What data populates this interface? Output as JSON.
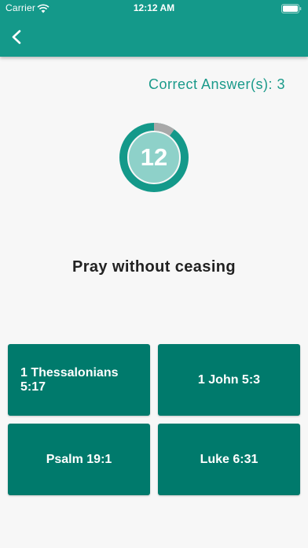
{
  "status_bar": {
    "carrier": "Carrier",
    "time": "12:12 AM"
  },
  "nav": {
    "back_icon": "chevron-left-icon"
  },
  "score": {
    "label": "Correct Answer(s): 3"
  },
  "timer": {
    "value": "12",
    "remaining_fraction": 0.9,
    "colors": {
      "ring": "#14998a",
      "elapsed": "#a8a8a8",
      "inner": "#8ed1c9"
    }
  },
  "question": {
    "text": "Pray without ceasing"
  },
  "answers": [
    {
      "label": "1 Thessalonians 5:17"
    },
    {
      "label": "1 John 5:3"
    },
    {
      "label": "Psalm 19:1"
    },
    {
      "label": "Luke 6:31"
    }
  ],
  "colors": {
    "primary": "#14998a",
    "answer_bg": "#007a6c",
    "accent_text": "#1a9a8a"
  }
}
